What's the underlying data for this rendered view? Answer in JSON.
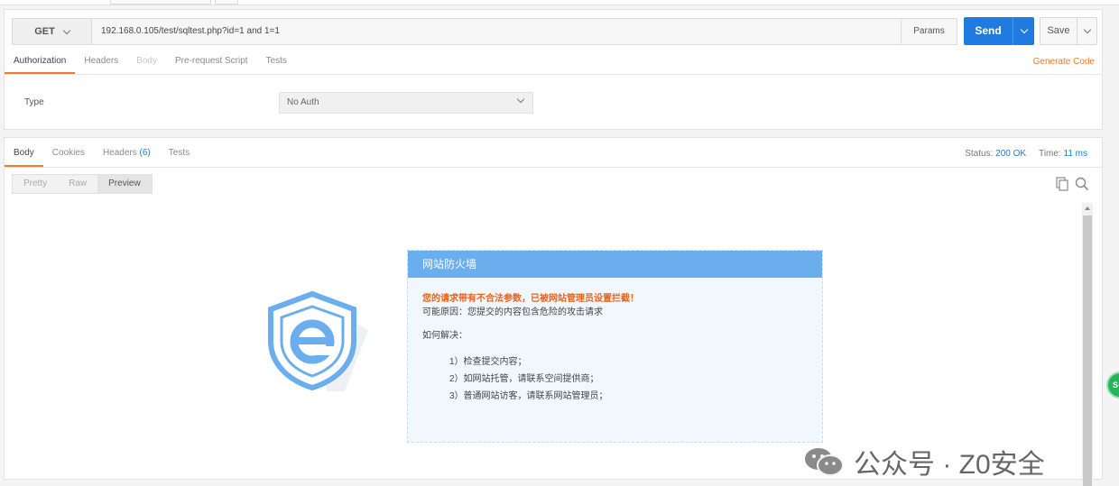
{
  "request": {
    "method": "GET",
    "url": "192.168.0.105/test/sqltest.php?id=1 and 1=1",
    "params_label": "Params",
    "send_label": "Send",
    "save_label": "Save",
    "tabs": [
      {
        "label": "Authorization",
        "active": true
      },
      {
        "label": "Headers",
        "active": false
      },
      {
        "label": "Body",
        "active": false,
        "disabled": true
      },
      {
        "label": "Pre-request Script",
        "active": false
      },
      {
        "label": "Tests",
        "active": false
      }
    ],
    "generate_code_label": "Generate Code",
    "auth": {
      "type_label": "Type",
      "selected": "No Auth"
    }
  },
  "response": {
    "tabs": [
      {
        "label": "Body",
        "active": true
      },
      {
        "label": "Cookies",
        "active": false
      },
      {
        "label": "Headers",
        "count": "(6)",
        "active": false
      },
      {
        "label": "Tests",
        "active": false
      }
    ],
    "status_label": "Status:",
    "status_value": "200 OK",
    "time_label": "Time:",
    "time_value": "11 ms",
    "format_buttons": [
      {
        "label": "Pretty",
        "active": false
      },
      {
        "label": "Raw",
        "active": false
      },
      {
        "label": "Preview",
        "active": true
      }
    ]
  },
  "firewall": {
    "title": "网站防火墙",
    "warning": "您的请求带有不合法参数，已被网站管理员设置拦截！",
    "reason": "可能原因：您提交的内容包含危险的攻击请求",
    "how_label": "如何解决：",
    "steps": [
      "1）检查提交内容；",
      "2）如网站托管，请联系空间提供商；",
      "3）普通网站访客，请联系网站管理员；"
    ]
  },
  "watermark": "公众号 · Z0安全",
  "side_button_label": "S+",
  "colors": {
    "accent_blue": "#1f7be0",
    "tab_active": "#f07a2a",
    "firewall_header": "#6aaeee",
    "warning": "#e8621c"
  }
}
